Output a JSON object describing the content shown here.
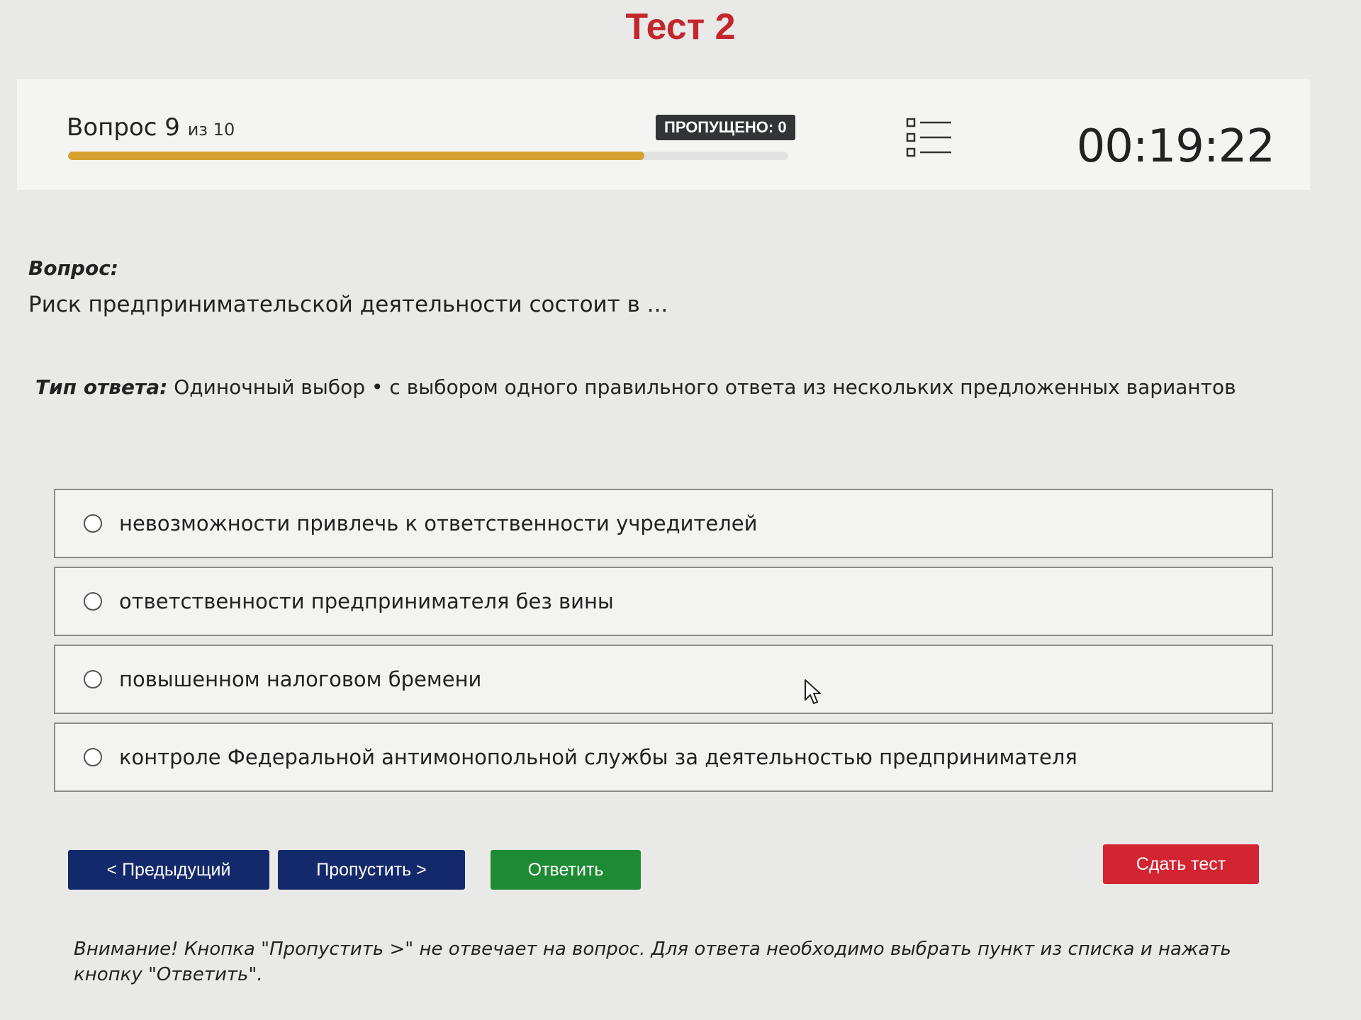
{
  "test": {
    "title": "Тест 2"
  },
  "progress": {
    "question_label": "Вопрос 9",
    "of_total": "из 10",
    "current": 9,
    "total": 10,
    "progress_fraction": 0.8,
    "skipped_badge": "ПРОПУЩЕНО: 0",
    "list_icon": "list-icon",
    "timer": "00:19:22"
  },
  "question": {
    "label": "Вопрос:",
    "text": "Риск предпринимательской деятельности состоит в ..."
  },
  "answer_type": {
    "label": "Тип ответа:",
    "value": "Одиночный выбор • с выбором одного правильного ответа из нескольких предложенных вариантов"
  },
  "options": [
    {
      "text": "невозможности привлечь к ответственности учредителей",
      "selected": false
    },
    {
      "text": "ответственности предпринимателя без вины",
      "selected": false
    },
    {
      "text": "повышенном налоговом бремени",
      "selected": false
    },
    {
      "text": "контроле Федеральной антимонопольной службы за деятельностью предпринимателя",
      "selected": false
    }
  ],
  "buttons": {
    "prev": "< Предыдущий",
    "skip": "Пропустить >",
    "answer": "Ответить",
    "submit": "Сдать тест"
  },
  "warning": "Внимание! Кнопка \"Пропустить >\" не отвечает на вопрос. Для ответа необходимо выбрать пункт из списка и нажать кнопку \"Ответить\".",
  "colors": {
    "title": "#c1272d",
    "progress": "#d6a030",
    "nav_buttons": "#13296b",
    "answer_button": "#1f8a34",
    "submit_button": "#d32431"
  }
}
